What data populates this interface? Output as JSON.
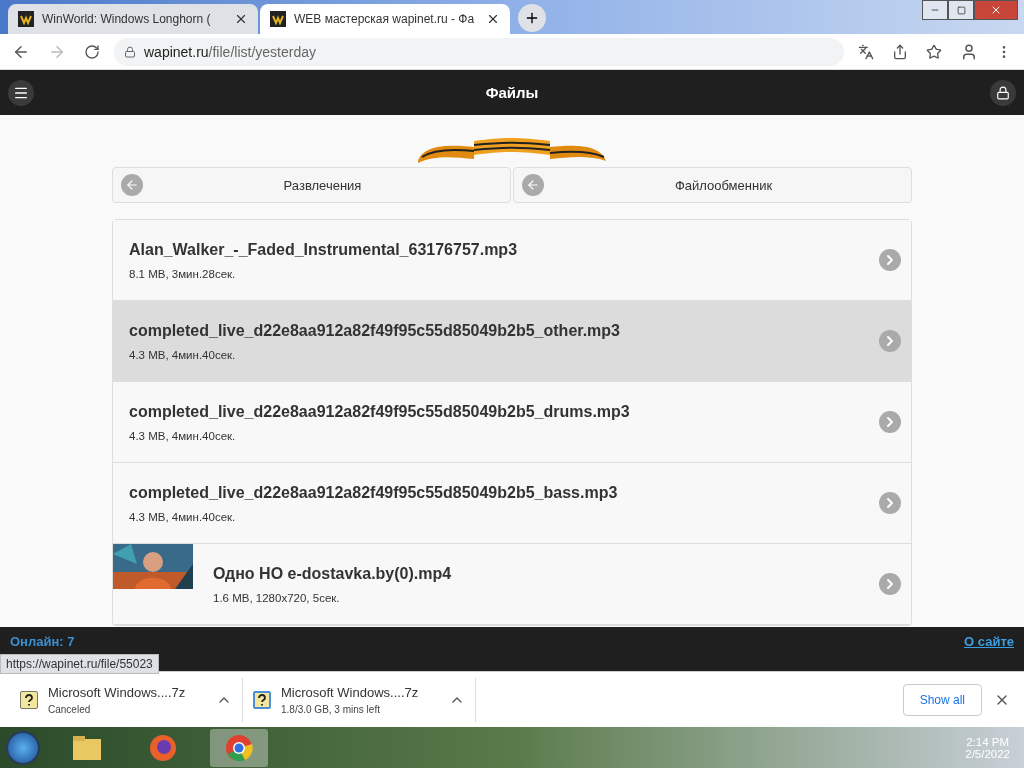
{
  "browser": {
    "tabs": [
      {
        "title": "WinWorld: Windows Longhorn (",
        "selected": false
      },
      {
        "title": "WEB мастерская wapinet.ru - Фа",
        "selected": true
      }
    ],
    "address": {
      "host": "wapinet.ru",
      "path": "/file/list/yesterday"
    }
  },
  "header": {
    "title": "Файлы"
  },
  "nav": [
    {
      "label": "Развлечения"
    },
    {
      "label": "Файлообменник"
    }
  ],
  "files": [
    {
      "name": "Alan_Walker_-_Faded_Instrumental_63176757.mp3",
      "info": "8.1 MB, 3мин.28сек.",
      "selected": false
    },
    {
      "name": "completed_live_d22e8aa912a82f49f95c55d85049b2b5_other.mp3",
      "info": "4.3 MB, 4мин.40сек.",
      "selected": true
    },
    {
      "name": "completed_live_d22e8aa912a82f49f95c55d85049b2b5_drums.mp3",
      "info": "4.3 MB, 4мин.40сек.",
      "selected": false
    },
    {
      "name": "completed_live_d22e8aa912a82f49f95c55d85049b2b5_bass.mp3",
      "info": "4.3 MB, 4мин.40сек.",
      "selected": false
    },
    {
      "name": "Одно НО e-dostavka.by(0).mp4",
      "info": "1.6 MB, 1280x720, 5сек.",
      "selected": false
    }
  ],
  "footer": {
    "online": "Онлайн: 7",
    "about": "О сайте"
  },
  "status_url": "https://wapinet.ru/file/55023",
  "downloads": [
    {
      "name": "Microsoft Windows....7z",
      "status": "Canceled",
      "kind": "canceled"
    },
    {
      "name": "Microsoft Windows....7z",
      "status": "1.8/3.0 GB, 3 mins left",
      "kind": "progress"
    }
  ],
  "show_all": "Show all",
  "clock": {
    "time": "2:14 PM",
    "date": "2/5/2022"
  }
}
